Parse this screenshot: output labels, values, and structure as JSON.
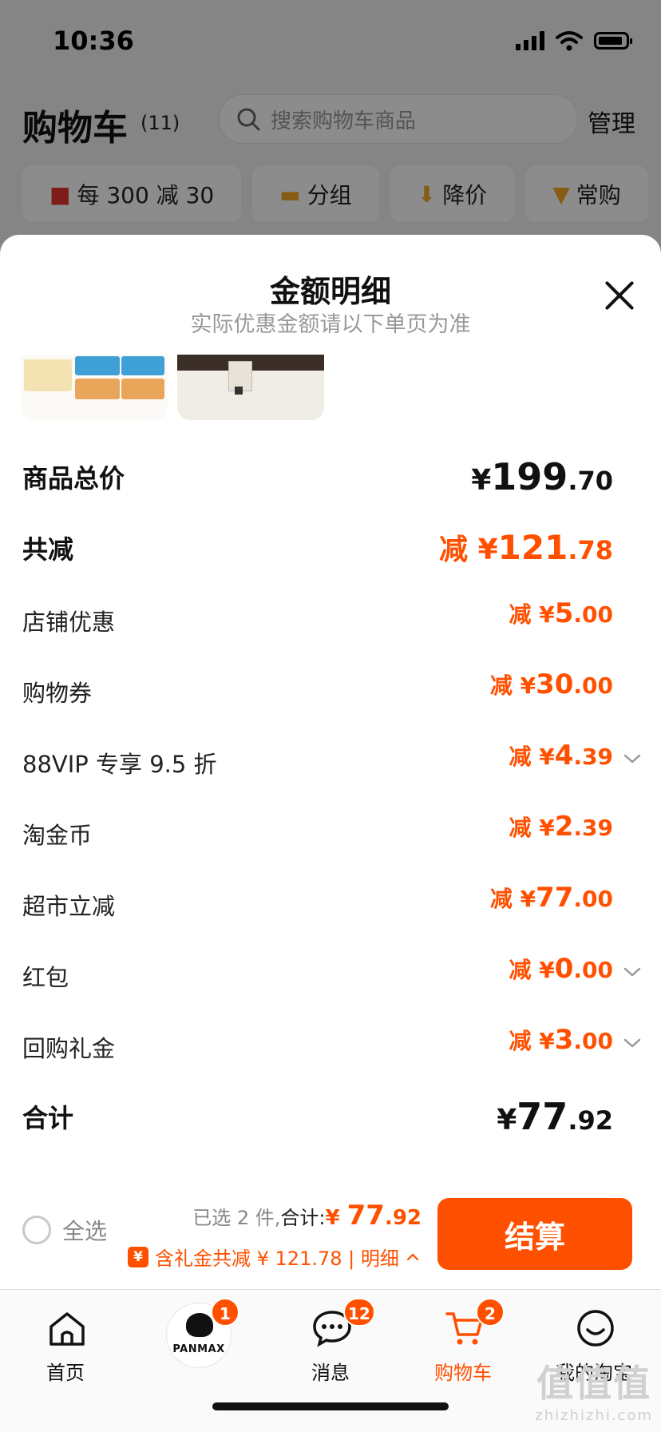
{
  "status_bar": {
    "time": "10:36"
  },
  "header": {
    "title": "购物车",
    "count": "(11)",
    "search_placeholder": "搜索购物车商品",
    "manage": "管理"
  },
  "filter_chips": [
    {
      "label": "每 300 减 30",
      "icon": "store-icon"
    },
    {
      "label": "分组",
      "icon": "folder-icon"
    },
    {
      "label": "降价",
      "icon": "price-drop-icon"
    },
    {
      "label": "常购",
      "icon": "cart-icon"
    }
  ],
  "sheet": {
    "title": "金额明细",
    "subtitle": "实际优惠金额请以下单页为准",
    "rows": [
      {
        "label": "商品总价",
        "prefix": "¥",
        "int": "199",
        "dec": ".70",
        "style": "total"
      },
      {
        "label": "共减",
        "prefix": "减 ¥",
        "int": "121",
        "dec": ".78",
        "style": "highlight"
      },
      {
        "label": "店铺优惠",
        "prefix": "减 ¥",
        "int": "5",
        "dec": ".00"
      },
      {
        "label": "购物券",
        "prefix": "减 ¥",
        "int": "30",
        "dec": ".00"
      },
      {
        "label": "88VIP 专享 9.5 折",
        "prefix": "减 ¥",
        "int": "4",
        "dec": ".39",
        "expandable": true
      },
      {
        "label": "淘金币",
        "prefix": "减 ¥",
        "int": "2",
        "dec": ".39"
      },
      {
        "label": "超市立减",
        "prefix": "减 ¥",
        "int": "77",
        "dec": ".00"
      },
      {
        "label": "红包",
        "prefix": "减 ¥",
        "int": "0",
        "dec": ".00",
        "expandable": true
      },
      {
        "label": "回购礼金",
        "prefix": "减 ¥",
        "int": "3",
        "dec": ".00",
        "expandable": true
      },
      {
        "label": "合计",
        "prefix": "¥",
        "int": "77",
        "dec": ".92",
        "style": "total"
      }
    ]
  },
  "checkout": {
    "select_all": "全选",
    "selected_text": "已选 2 件,",
    "total_label": "合计:",
    "total_prefix": "¥ ",
    "total_int": "77",
    "total_dec": ".92",
    "gift_icon": "¥",
    "gift_text": "含礼金共减 ¥ 121.78 | 明细",
    "gift_caret": "^",
    "button": "结算"
  },
  "tabbar": {
    "tabs": [
      {
        "label": "首页",
        "icon": "home-icon"
      },
      {
        "label": "",
        "icon": "avatar",
        "badge": "1",
        "avatar_text": "PANMAX"
      },
      {
        "label": "消息",
        "icon": "message-icon",
        "badge": "12"
      },
      {
        "label": "购物车",
        "icon": "cart-icon",
        "badge": "2",
        "active": true
      },
      {
        "label": "我的淘宝",
        "icon": "profile-icon"
      }
    ]
  },
  "watermark": {
    "glyphs": "值值值",
    "site": "zhizhizhi.com"
  },
  "colors": {
    "accent": "#ff5000",
    "text": "#111111",
    "muted": "#999999"
  }
}
